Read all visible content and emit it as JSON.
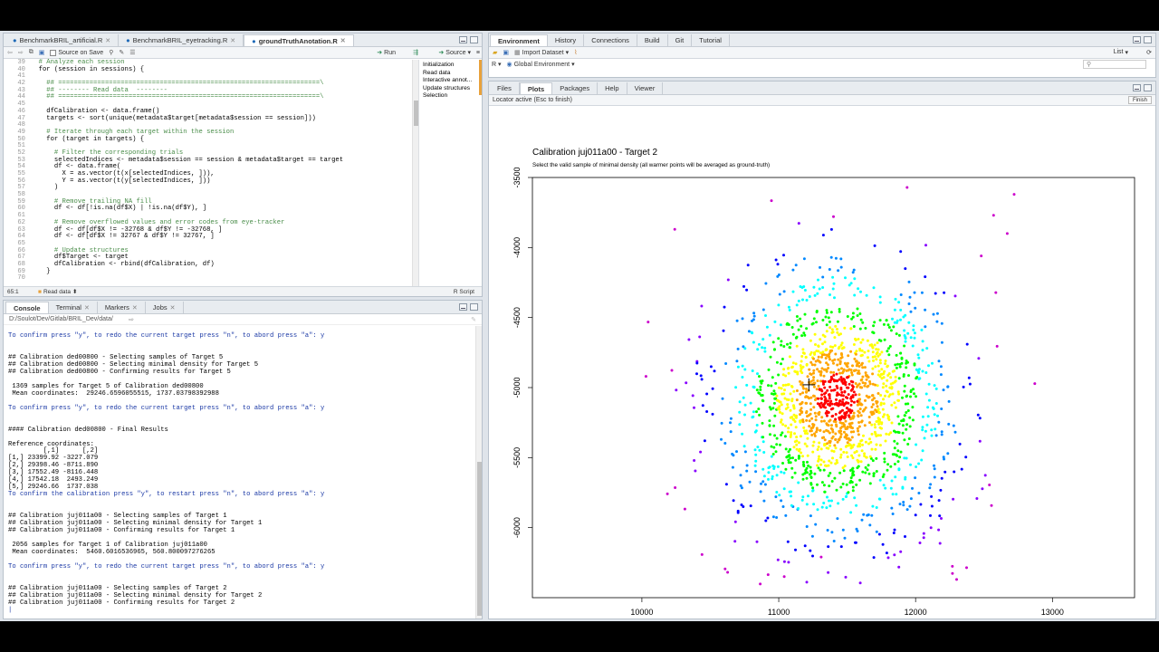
{
  "editor": {
    "tabs": [
      {
        "label": "BenchmarkBRIL_artificial.R"
      },
      {
        "label": "BenchmarkBRIL_eyetracking.R"
      },
      {
        "label": "groundTruthAnotation.R"
      }
    ],
    "toolbar": {
      "source_on_save": "Source on Save",
      "run": "Run",
      "source": "Source"
    },
    "lines": [
      {
        "n": "39",
        "text": "  # Analyze each session",
        "cls": "c-com"
      },
      {
        "n": "40",
        "text": "  for (session in sessions) {",
        "cls": "src"
      },
      {
        "n": "41",
        "text": "",
        "cls": "src"
      },
      {
        "n": "42",
        "text": "    ## ===================================================================\\",
        "cls": "c-com"
      },
      {
        "n": "43",
        "text": "    ## -------- Read data  --------",
        "cls": "c-com"
      },
      {
        "n": "44",
        "text": "    ## ===================================================================\\",
        "cls": "c-com"
      },
      {
        "n": "45",
        "text": "",
        "cls": "src"
      },
      {
        "n": "46",
        "text": "    dfCalibration <- data.frame()",
        "cls": "src"
      },
      {
        "n": "47",
        "text": "    targets <- sort(unique(metadata$target[metadata$session == session]))",
        "cls": "src"
      },
      {
        "n": "48",
        "text": "",
        "cls": "src"
      },
      {
        "n": "49",
        "text": "    # Iterate through each target within the session",
        "cls": "c-com"
      },
      {
        "n": "50",
        "text": "    for (target in targets) {",
        "cls": "src"
      },
      {
        "n": "51",
        "text": "",
        "cls": "src"
      },
      {
        "n": "52",
        "text": "      # Filter the corresponding trials",
        "cls": "c-com"
      },
      {
        "n": "53",
        "text": "      selectedIndices <- metadata$session == session & metadata$target == target",
        "cls": "src"
      },
      {
        "n": "54",
        "text": "      df <- data.frame(",
        "cls": "src"
      },
      {
        "n": "55",
        "text": "        X = as.vector(t(x[selectedIndices, ])),",
        "cls": "src"
      },
      {
        "n": "56",
        "text": "        Y = as.vector(t(y[selectedIndices, ]))",
        "cls": "src"
      },
      {
        "n": "57",
        "text": "      )",
        "cls": "src"
      },
      {
        "n": "58",
        "text": "",
        "cls": "src"
      },
      {
        "n": "59",
        "text": "      # Remove trailing NA fill",
        "cls": "c-com"
      },
      {
        "n": "60",
        "text": "      df <- df[!is.na(df$X) | !is.na(df$Y), ]",
        "cls": "src"
      },
      {
        "n": "61",
        "text": "",
        "cls": "src"
      },
      {
        "n": "62",
        "text": "      # Remove overflowed values and error codes from eye-tracker",
        "cls": "c-com"
      },
      {
        "n": "63",
        "text": "      df <- df[df$X != -32768 & df$Y != -32768, ]",
        "cls": "src"
      },
      {
        "n": "64",
        "text": "      df <- df[df$X != 32767 & df$Y != 32767, ]",
        "cls": "src"
      },
      {
        "n": "65",
        "text": "",
        "cls": "src"
      },
      {
        "n": "66",
        "text": "      # Update structures",
        "cls": "c-com"
      },
      {
        "n": "67",
        "text": "      df$Target <- target",
        "cls": "src"
      },
      {
        "n": "68",
        "text": "      dfCalibration <- rbind(dfCalibration, df)",
        "cls": "src"
      },
      {
        "n": "69",
        "text": "    }",
        "cls": "src"
      },
      {
        "n": "70",
        "text": "",
        "cls": "src"
      }
    ],
    "outline": [
      "Initialization",
      "Read data",
      "Interactive annot...",
      "Update structures",
      "Selection"
    ],
    "status_pos": "65:1",
    "status_section": "Read data",
    "status_lang": "R Script"
  },
  "console": {
    "tabs": [
      {
        "label": "Console"
      },
      {
        "label": "Terminal"
      },
      {
        "label": "Markers"
      },
      {
        "label": "Jobs"
      }
    ],
    "path": "D:/Soulot/Dev/Gitlab/BRIL_Dev/data/",
    "lines": [
      {
        "text": "",
        "cls": "out"
      },
      {
        "text": "To confirm press \"y\", to redo the current target press \"n\", to abord press \"a\": y",
        "cls": "prompt"
      },
      {
        "text": "",
        "cls": "out"
      },
      {
        "text": "",
        "cls": "out"
      },
      {
        "text": "## Calibration ded00800 - Selecting samples of Target 5",
        "cls": "out"
      },
      {
        "text": "## Calibration ded00800 - Selecting minimal density for Target 5",
        "cls": "out"
      },
      {
        "text": "## Calibration ded00800 - Confirming results for Target 5",
        "cls": "out"
      },
      {
        "text": "",
        "cls": "out"
      },
      {
        "text": " 1369 samples for Target 5 of Calibration ded00800",
        "cls": "out"
      },
      {
        "text": " Mean coordinates:  29246.6596055515, 1737.03798392988",
        "cls": "out"
      },
      {
        "text": "",
        "cls": "out"
      },
      {
        "text": "To confirm press \"y\", to redo the current target press \"n\", to abord press \"a\": y",
        "cls": "prompt"
      },
      {
        "text": "",
        "cls": "out"
      },
      {
        "text": "",
        "cls": "out"
      },
      {
        "text": "#### Calibration ded00800 - Final Results",
        "cls": "out"
      },
      {
        "text": "",
        "cls": "out"
      },
      {
        "text": "Reference coordinates:",
        "cls": "out"
      },
      {
        "text": "         [,1]      [,2]",
        "cls": "out"
      },
      {
        "text": "[1,] 23399.92 -3227.079",
        "cls": "out"
      },
      {
        "text": "[2,] 29398.46 -8711.890",
        "cls": "out"
      },
      {
        "text": "[3,] 17552.49 -8116.448",
        "cls": "out"
      },
      {
        "text": "[4,] 17542.18  2493.249",
        "cls": "out"
      },
      {
        "text": "[5,] 29246.66  1737.038",
        "cls": "out"
      },
      {
        "text": "To confirm the calibration press \"y\", to restart press \"n\", to abord press \"a\": y",
        "cls": "prompt"
      },
      {
        "text": "",
        "cls": "out"
      },
      {
        "text": "",
        "cls": "out"
      },
      {
        "text": "## Calibration juj011a00 - Selecting samples of Target 1",
        "cls": "out"
      },
      {
        "text": "## Calibration juj011a00 - Selecting minimal density for Target 1",
        "cls": "out"
      },
      {
        "text": "## Calibration juj011a00 - Confirming results for Target 1",
        "cls": "out"
      },
      {
        "text": "",
        "cls": "out"
      },
      {
        "text": " 2056 samples for Target 1 of Calibration juj011a00",
        "cls": "out"
      },
      {
        "text": " Mean coordinates:  5460.6016536965, 560.800097276265",
        "cls": "out"
      },
      {
        "text": "",
        "cls": "out"
      },
      {
        "text": "To confirm press \"y\", to redo the current target press \"n\", to abord press \"a\": y",
        "cls": "prompt"
      },
      {
        "text": "",
        "cls": "out"
      },
      {
        "text": "",
        "cls": "out"
      },
      {
        "text": "## Calibration juj011a00 - Selecting samples of Target 2",
        "cls": "out"
      },
      {
        "text": "## Calibration juj011a00 - Selecting minimal density for Target 2",
        "cls": "out"
      },
      {
        "text": "## Calibration juj011a00 - Confirming results for Target 2",
        "cls": "out"
      },
      {
        "text": "|",
        "cls": "prompt"
      }
    ]
  },
  "env": {
    "tabs": [
      {
        "label": "Environment"
      },
      {
        "label": "History"
      },
      {
        "label": "Connections"
      },
      {
        "label": "Build"
      },
      {
        "label": "Git"
      },
      {
        "label": "Tutorial"
      }
    ],
    "import_label": "Import Dataset",
    "list_label": "List",
    "lang": "R",
    "scope": "Global Environment"
  },
  "files": {
    "tabs": [
      {
        "label": "Files"
      },
      {
        "label": "Plots"
      },
      {
        "label": "Packages"
      },
      {
        "label": "Help"
      },
      {
        "label": "Viewer"
      }
    ],
    "locator_msg": "Locator active (Esc to finish)",
    "finish_label": "Finish"
  },
  "chart_data": {
    "type": "scatter",
    "title": "Calibration juj011a00 - Target 2",
    "subtitle": "Select the valid sample of minimal density (all warmer points will be averaged as ground-truth)",
    "xlim": [
      9200,
      13600
    ],
    "ylim": [
      -6500,
      -3500
    ],
    "x_ticks": [
      10000,
      11000,
      12000,
      13000
    ],
    "y_ticks": [
      -3500,
      -4000,
      -4500,
      -5000,
      -5500,
      -6000
    ],
    "y_reversed": true,
    "cluster_center": [
      11430,
      -5010
    ],
    "cursor": [
      11220,
      -4980
    ],
    "color_scale": [
      "#ff0000",
      "#ffa500",
      "#ffff00",
      "#00ff00",
      "#00ffff",
      "#0088ff",
      "#0000ff",
      "#8800ff",
      "#cc00cc"
    ],
    "outliers": [
      [
        10030,
        -4920
      ],
      [
        10240,
        -3870
      ],
      [
        11400,
        -3780
      ],
      [
        12720,
        -3620
      ],
      [
        12570,
        -3770
      ],
      [
        12670,
        -3900
      ],
      [
        12480,
        -4060
      ],
      [
        11040,
        -6350
      ],
      [
        12300,
        -6370
      ],
      [
        11310,
        -6210
      ]
    ]
  }
}
